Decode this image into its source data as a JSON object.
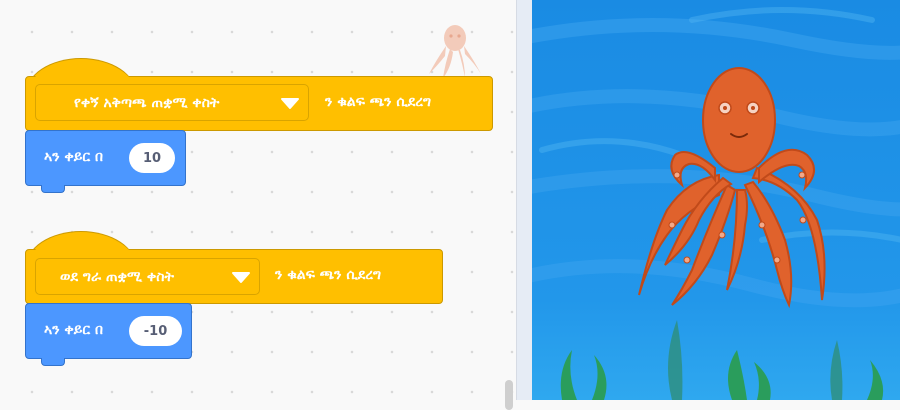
{
  "script1": {
    "key_option": "የቀኝ አቅጣጫ ጠቋሚ ቀስት",
    "hat_suffix": "ን ቁልፍ ጫን ሲደረግ",
    "move_label": "ኣን ቀይር በ",
    "move_value": "10"
  },
  "script2": {
    "key_option": "ወደ ግራ ጠቋሚ ቀስት",
    "hat_suffix": "ን ቁልፍ ጫን ሲደረግ",
    "move_label": "ኣን ቀይር በ",
    "move_value": "-10"
  },
  "stage": {
    "sprite": "octopus",
    "background_color": "#1e8fe6"
  },
  "colors": {
    "events": "#ffbf00",
    "motion": "#4c97ff"
  },
  "icons": [
    "dropdown-arrow-icon",
    "octopus-sprite-icon"
  ]
}
